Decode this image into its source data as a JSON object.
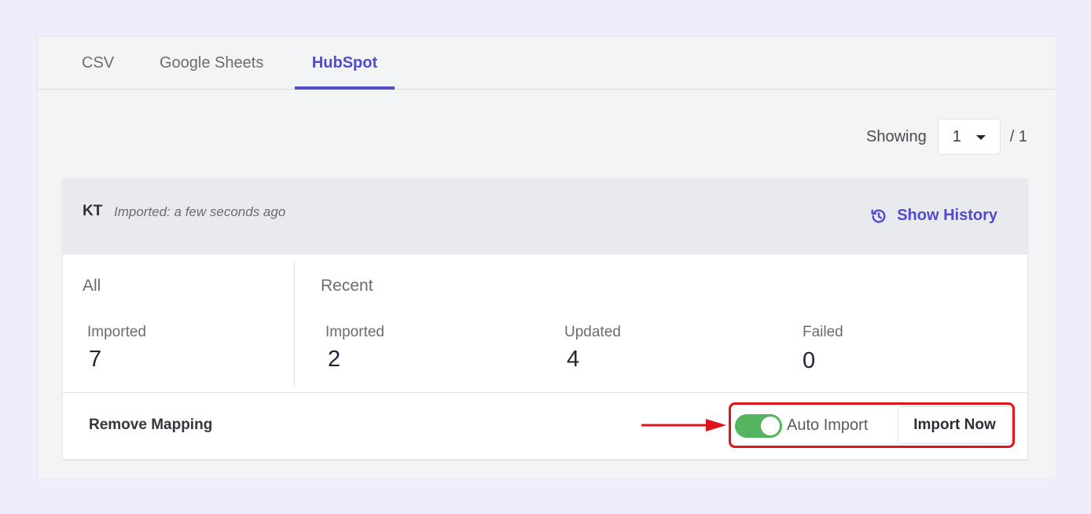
{
  "tabs": [
    {
      "label": "CSV",
      "active": false
    },
    {
      "label": "Google Sheets",
      "active": false
    },
    {
      "label": "HubSpot",
      "active": true
    }
  ],
  "pager": {
    "prefix": "Showing",
    "current_page": "1",
    "suffix": "/ 1"
  },
  "mapping": {
    "name": "KT",
    "imported_time": "Imported: a few seconds ago",
    "show_history_label": "Show History",
    "all": {
      "label": "All",
      "stats": [
        {
          "label": "Imported",
          "value": "7"
        }
      ]
    },
    "recent": {
      "label": "Recent",
      "stats": [
        {
          "label": "Imported",
          "value": "2"
        },
        {
          "label": "Updated",
          "value": "4"
        },
        {
          "label": "Failed",
          "value": "0"
        }
      ]
    },
    "remove_mapping_label": "Remove Mapping",
    "auto_import": {
      "label": "Auto Import",
      "enabled": true
    },
    "import_now_label": "Import Now"
  },
  "colors": {
    "accent": "#4f4ccf",
    "toggle_on": "#55b45e",
    "annotation": "#e0121a",
    "background": "#ededfb"
  }
}
